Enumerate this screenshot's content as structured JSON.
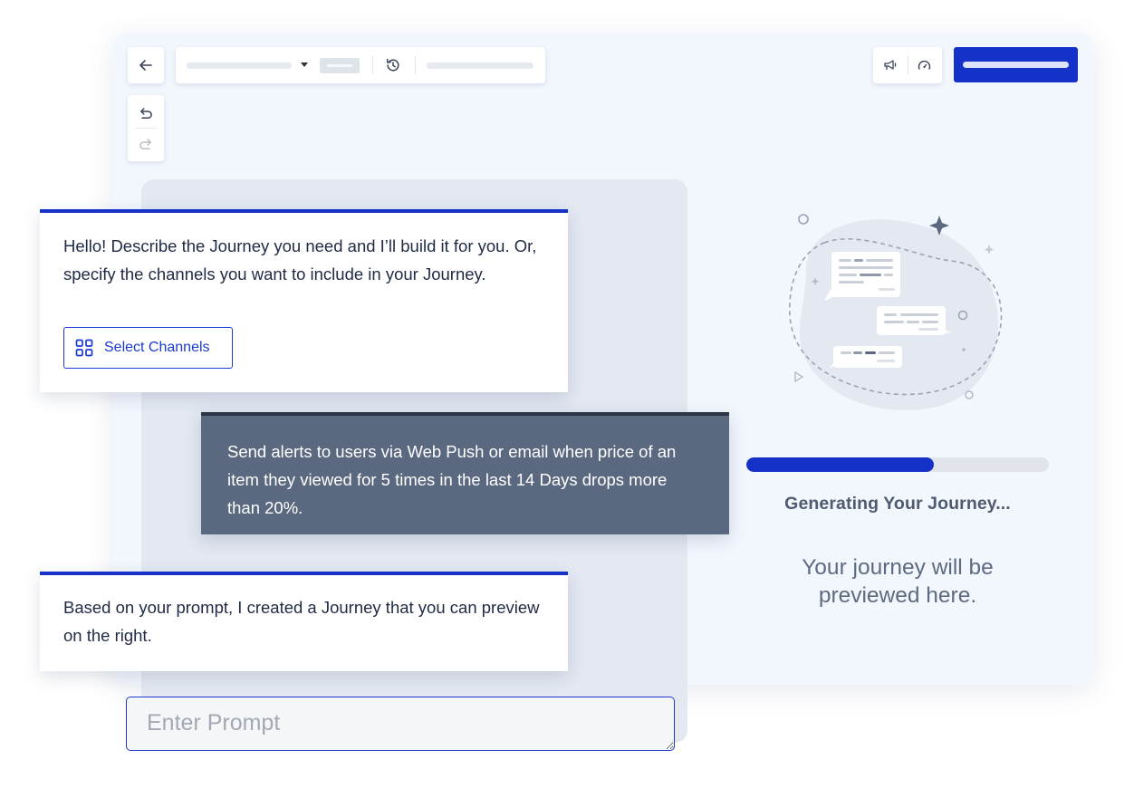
{
  "toolbar": {
    "back_icon": "arrow-left-icon",
    "dropdown_icon": "caret-down-icon",
    "history_icon": "history-icon",
    "undo_icon": "undo-icon",
    "redo_icon": "redo-icon",
    "megaphone_icon": "megaphone-icon",
    "gauge_icon": "gauge-icon",
    "accent_color": "#1432c8"
  },
  "chat": {
    "messages": [
      {
        "role": "assistant",
        "text": "Hello! Describe the Journey you need and I’ll build it for you. Or, specify the channels you want to include in your Journey.",
        "button": {
          "icon": "grid-icon",
          "label": "Select Channels"
        }
      },
      {
        "role": "user",
        "text": "Send alerts to users via Web Push or email when price of an item they viewed for 5 times in the last 14 Days drops more than 20%."
      },
      {
        "role": "assistant",
        "text": "Based on your prompt, I created a Journey that you can preview on the right."
      }
    ],
    "input": {
      "placeholder": "Enter Prompt",
      "value": ""
    }
  },
  "preview": {
    "illustration_icon": "chat-bubbles-illustration",
    "progress_percent": 62,
    "status_text": "Generating Your Journey...",
    "placeholder_text": "Your journey will be previewed here."
  }
}
